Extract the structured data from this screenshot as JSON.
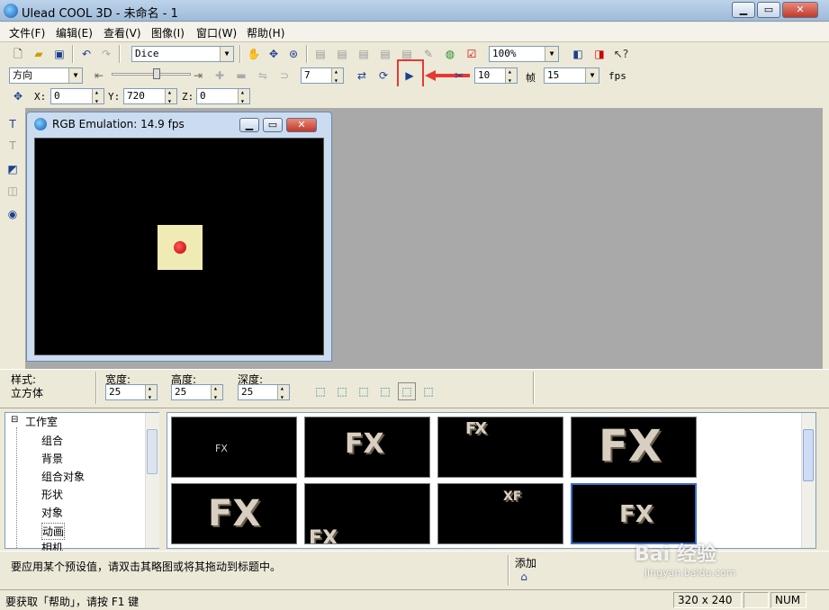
{
  "window": {
    "title": "Ulead COOL 3D - 未命名 - 1"
  },
  "menu": [
    "文件(F)",
    "编辑(E)",
    "查看(V)",
    "图像(I)",
    "窗口(W)",
    "帮助(H)"
  ],
  "toolbar1": {
    "font_combo": "Dice",
    "zoom_combo": "100%"
  },
  "toolbar2": {
    "direction_combo": "方向",
    "rotate_value": "7",
    "frame_value": "10",
    "frame_label": "帧",
    "fps_value": "15",
    "fps_label": "fps"
  },
  "toolbar3": {
    "x_label": "X:",
    "x_value": "0",
    "y_label": "Y:",
    "y_value": "720",
    "z_label": "Z:",
    "z_value": "0"
  },
  "child_window": {
    "title": "RGB Emulation: 14.9 fps"
  },
  "props": {
    "style_label": "样式:",
    "style_value": "立方体",
    "width_label": "宽度:",
    "width_value": "25",
    "height_label": "高度:",
    "height_value": "25",
    "depth_label": "深度:",
    "depth_value": "25"
  },
  "tree": {
    "root": "工作室",
    "items": [
      "组合",
      "背景",
      "组合对象",
      "形状",
      "对象",
      "动画",
      "相机"
    ]
  },
  "gallery": {
    "thumbs": [
      "FX",
      "FX",
      "FX",
      "FX",
      "FX",
      "FX",
      "XF",
      "FX"
    ]
  },
  "hint": {
    "text": "要应用某个预设值，请双击其略图或将其拖动到标题中。",
    "add_label": "添加"
  },
  "status": {
    "help_text": "要获取「帮助」，请按 F1 键",
    "size": "320 x 240",
    "num": "NUM"
  },
  "watermark": {
    "brand": "Bai 经验",
    "url": "jingyan.baidu.com"
  },
  "colors": {
    "highlight": "#e53935",
    "canvas": "#000000",
    "workspace": "#a9a9a9"
  }
}
